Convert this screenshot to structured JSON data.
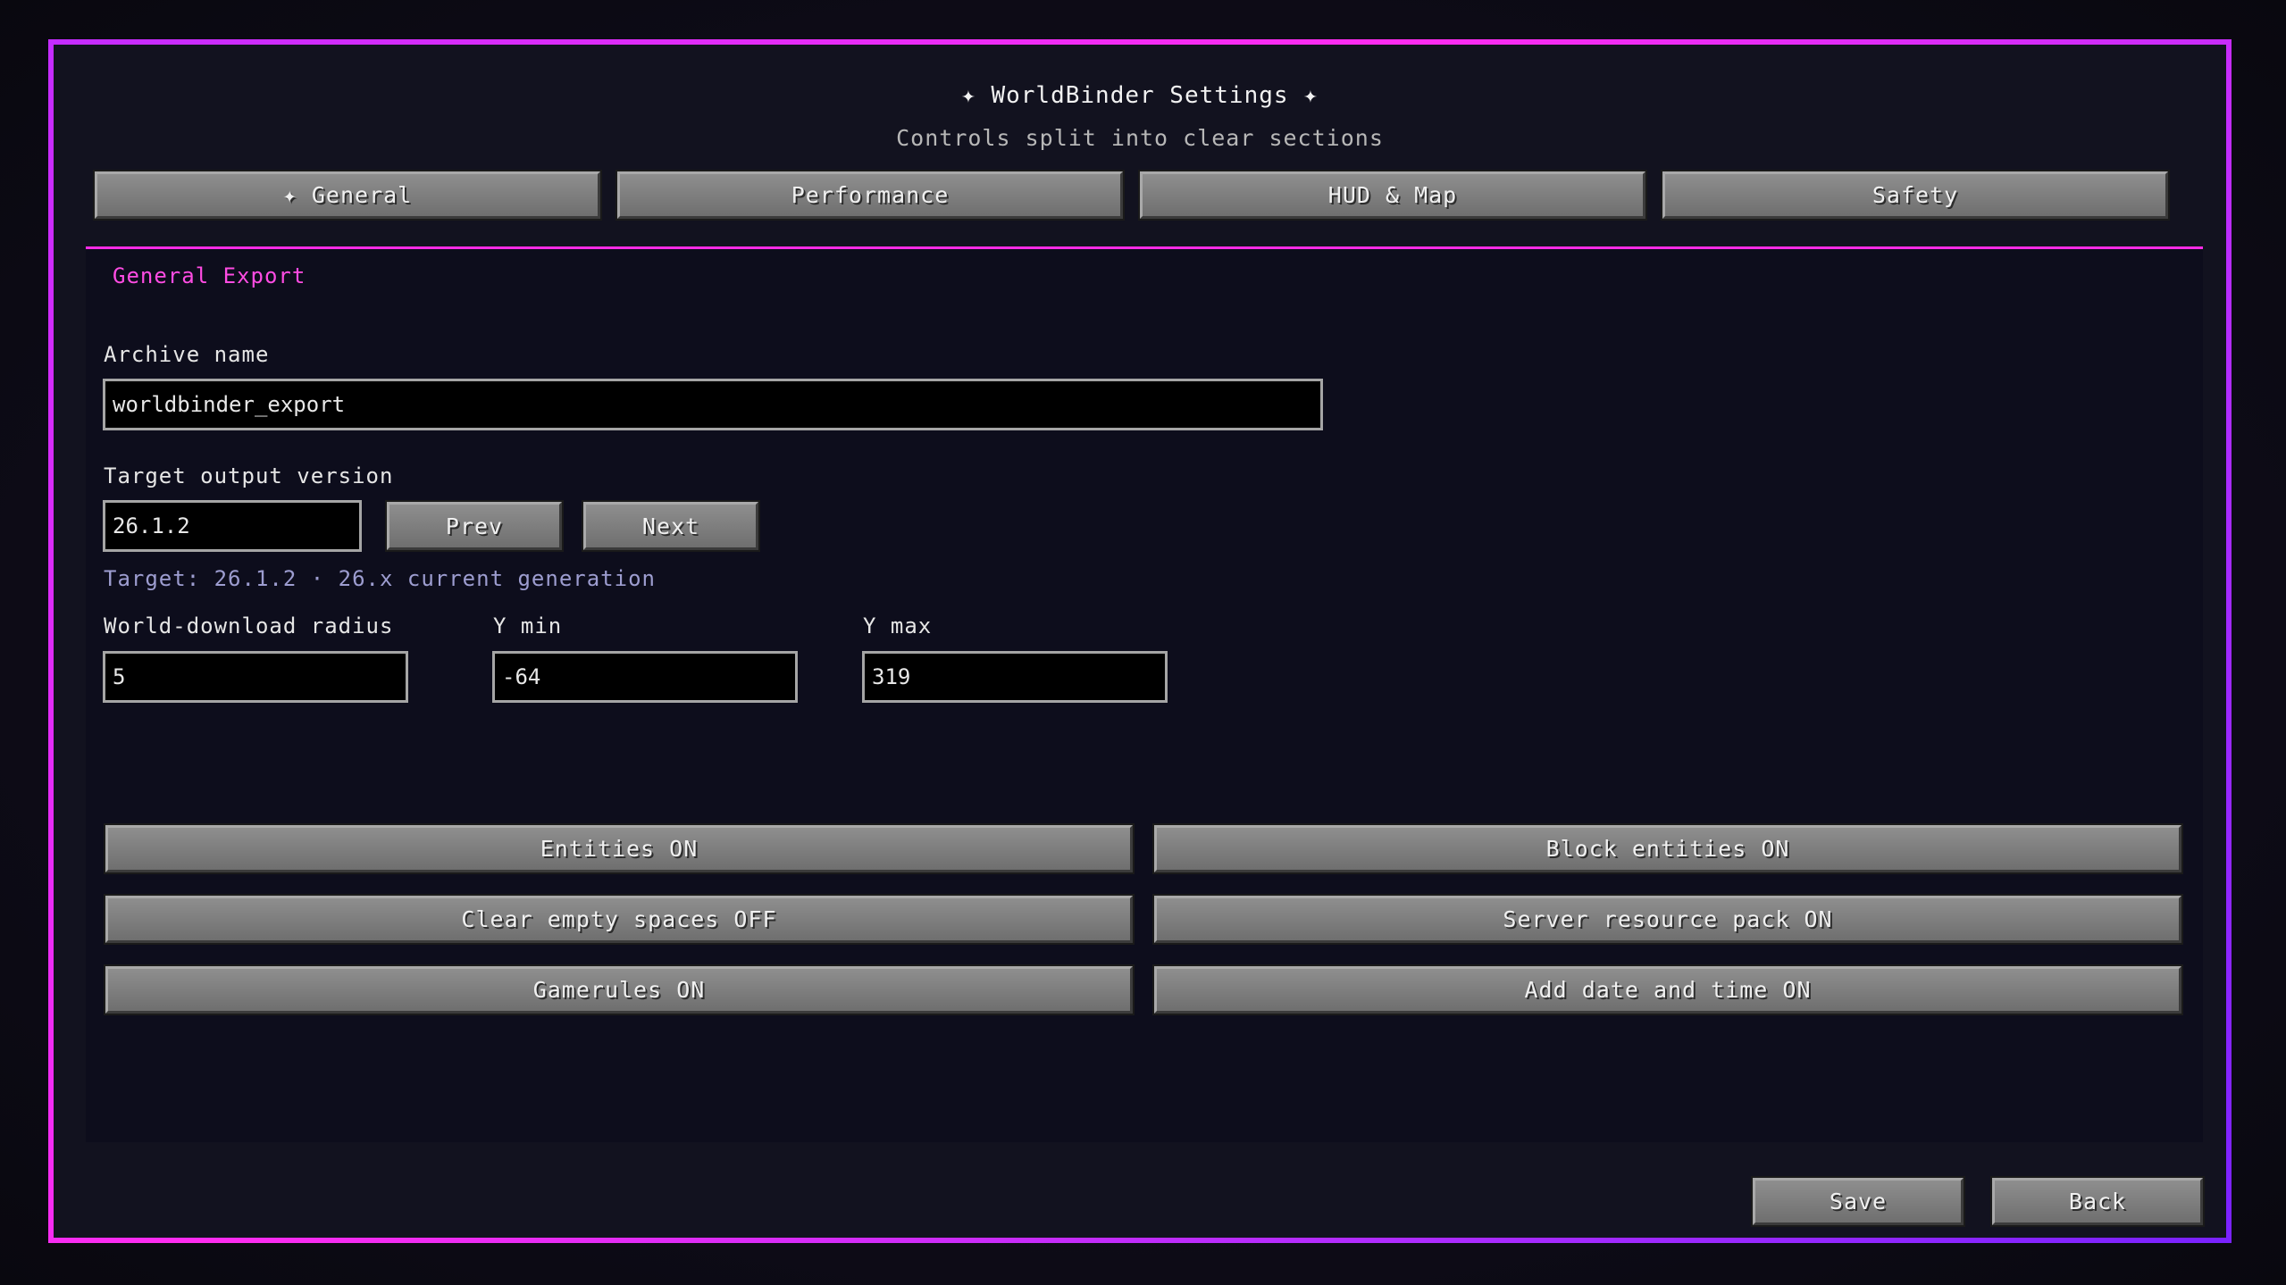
{
  "header": {
    "title": "✦ WorldBinder Settings ✦",
    "subtitle": "Controls split into clear sections"
  },
  "tabs": [
    {
      "label": "✦ General",
      "active": true
    },
    {
      "label": "Performance",
      "active": false
    },
    {
      "label": "HUD & Map",
      "active": false
    },
    {
      "label": "Safety",
      "active": false
    }
  ],
  "section": {
    "title": "General Export"
  },
  "archive": {
    "label": "Archive name",
    "value": "worldbinder_export"
  },
  "version": {
    "label": "Target output version",
    "value": "26.1.2",
    "prev_label": "Prev",
    "next_label": "Next",
    "hint": "Target: 26.1.2 · 26.x current generation"
  },
  "radius": {
    "label": "World-download radius",
    "value": "5"
  },
  "ymin": {
    "label": "Y min",
    "value": "-64"
  },
  "ymax": {
    "label": "Y max",
    "value": "319"
  },
  "toggles": [
    {
      "label": "Entities ON"
    },
    {
      "label": "Block entities ON"
    },
    {
      "label": "Clear empty spaces OFF"
    },
    {
      "label": "Server resource pack ON"
    },
    {
      "label": "Gamerules ON"
    },
    {
      "label": "Add date and time ON"
    }
  ],
  "footer": {
    "save_label": "Save",
    "back_label": "Back"
  },
  "colors": {
    "accent": "#ff2ce6",
    "frame_start": "#c42cff",
    "frame_end": "#7a22ff",
    "hint": "#9d9dd0"
  }
}
